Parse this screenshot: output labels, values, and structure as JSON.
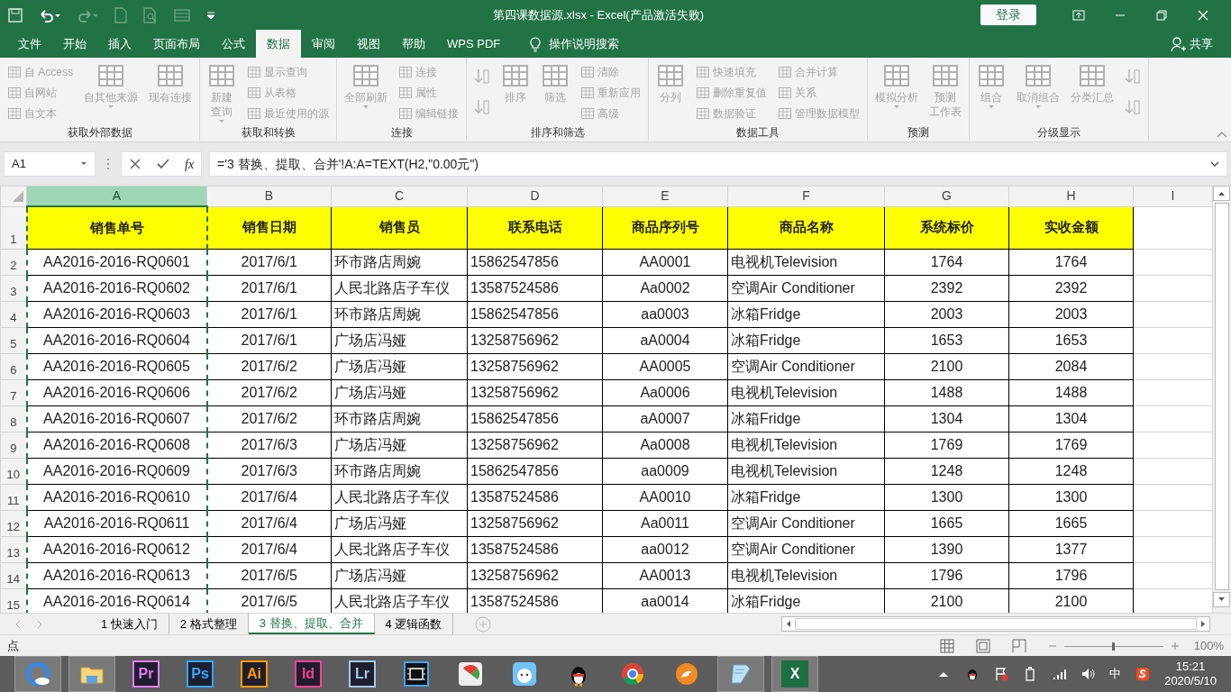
{
  "title_bar": {
    "title": "第四课数据源.xlsx  -  Excel(产品激活失败)",
    "login": "登录"
  },
  "ribbon": {
    "tabs": [
      {
        "label": "文件",
        "selected": false
      },
      {
        "label": "开始",
        "selected": false
      },
      {
        "label": "插入",
        "selected": false
      },
      {
        "label": "页面布局",
        "selected": false
      },
      {
        "label": "公式",
        "selected": false
      },
      {
        "label": "数据",
        "selected": true
      },
      {
        "label": "审阅",
        "selected": false
      },
      {
        "label": "视图",
        "selected": false
      },
      {
        "label": "帮助",
        "selected": false
      },
      {
        "label": "WPS PDF",
        "selected": false
      }
    ],
    "tell_me": "操作说明搜索",
    "share": "共享",
    "groups": [
      {
        "label": "获取外部数据",
        "columns": [
          {
            "kind": "stack",
            "items": [
              {
                "label": "自 Access",
                "disabled": true
              },
              {
                "label": "自网站",
                "disabled": true
              },
              {
                "label": "自文本",
                "disabled": true
              }
            ]
          },
          {
            "kind": "large",
            "lines": [
              "自其他来源"
            ],
            "dropdown": true,
            "disabled": true
          },
          {
            "kind": "large",
            "lines": [
              "现有连接"
            ],
            "dropdown": false,
            "disabled": true
          }
        ]
      },
      {
        "label": "获取和转换",
        "columns": [
          {
            "kind": "large",
            "lines": [
              "新建",
              "查询"
            ],
            "dropdown": true,
            "disabled": true
          },
          {
            "kind": "stack",
            "items": [
              {
                "label": "显示查询",
                "disabled": true
              },
              {
                "label": "从表格",
                "disabled": true
              },
              {
                "label": "最近使用的源",
                "disabled": true
              }
            ]
          }
        ]
      },
      {
        "label": "连接",
        "columns": [
          {
            "kind": "large",
            "lines": [
              "全部刷新"
            ],
            "dropdown": true,
            "disabled": true
          },
          {
            "kind": "stack",
            "items": [
              {
                "label": "连接",
                "disabled": true
              },
              {
                "label": "属性",
                "disabled": true
              },
              {
                "label": "编辑链接",
                "disabled": true
              }
            ]
          }
        ]
      },
      {
        "label": "排序和筛选",
        "columns": [
          {
            "kind": "stack",
            "items": [
              {
                "disabled": true
              },
              {
                "disabled": true
              }
            ]
          },
          {
            "kind": "large",
            "lines": [
              "排序"
            ],
            "dropdown": false,
            "disabled": true
          },
          {
            "kind": "large",
            "lines": [
              "筛选"
            ],
            "dropdown": false,
            "disabled": true
          },
          {
            "kind": "stack",
            "items": [
              {
                "label": "清除",
                "disabled": true
              },
              {
                "label": "重新应用",
                "disabled": true
              },
              {
                "label": "高级",
                "disabled": true
              }
            ]
          }
        ]
      },
      {
        "label": "数据工具",
        "columns": [
          {
            "kind": "large",
            "lines": [
              "分列"
            ],
            "dropdown": false,
            "disabled": true
          },
          {
            "kind": "stack",
            "items": [
              {
                "label": "快速填充",
                "disabled": true
              },
              {
                "label": "删除重复值",
                "disabled": true
              },
              {
                "label": "数据验证",
                "disabled": true
              }
            ]
          },
          {
            "kind": "stack",
            "items": [
              {
                "label": "合并计算",
                "disabled": true
              },
              {
                "label": "关系",
                "disabled": true
              },
              {
                "label": "管理数据模型",
                "disabled": true
              }
            ]
          }
        ]
      },
      {
        "label": "预测",
        "columns": [
          {
            "kind": "large",
            "lines": [
              "模拟分析"
            ],
            "dropdown": true,
            "disabled": true
          },
          {
            "kind": "large",
            "lines": [
              "预测",
              "工作表"
            ],
            "dropdown": false,
            "disabled": true
          }
        ]
      },
      {
        "label": "分级显示",
        "columns": [
          {
            "kind": "large",
            "lines": [
              "组合"
            ],
            "dropdown": true,
            "disabled": true
          },
          {
            "kind": "large",
            "lines": [
              "取消组合"
            ],
            "dropdown": true,
            "disabled": true
          },
          {
            "kind": "large",
            "lines": [
              "分类汇总"
            ],
            "dropdown": false,
            "disabled": true
          },
          {
            "kind": "stack",
            "items": [
              {
                "disabled": true
              },
              {
                "disabled": true
              }
            ]
          }
        ]
      }
    ]
  },
  "formula_bar": {
    "name_box": "A1",
    "function_label": "fx",
    "formula": "='3 替换、提取、合并'!A:A=TEXT(H2,\"0.00元\")"
  },
  "sheet": {
    "columns": [
      {
        "letter": "A",
        "selected": true,
        "marquee": true
      },
      {
        "letter": "B",
        "selected": false,
        "marquee": false
      },
      {
        "letter": "C",
        "selected": false,
        "marquee": false
      },
      {
        "letter": "D",
        "selected": false,
        "marquee": false
      },
      {
        "letter": "E",
        "selected": false,
        "marquee": false
      },
      {
        "letter": "F",
        "selected": false,
        "marquee": false
      },
      {
        "letter": "G",
        "selected": false,
        "marquee": false
      },
      {
        "letter": "H",
        "selected": false,
        "marquee": false
      },
      {
        "letter": "I",
        "selected": false,
        "marquee": false
      }
    ],
    "rows": [
      {
        "number": "1",
        "kind": "header",
        "cells": [
          "销售单号",
          "销售日期",
          "销售员",
          "联系电话",
          "商品序列号",
          "商品名称",
          "系统标价",
          "实收金额"
        ]
      },
      {
        "number": "2",
        "kind": "data",
        "cells": [
          "AA2016-2016-RQ0601",
          "2017/6/1",
          "环市路店周婉",
          "15862547856",
          "AA0001",
          "电视机Television",
          "1764",
          "1764"
        ]
      },
      {
        "number": "3",
        "kind": "data",
        "cells": [
          "AA2016-2016-RQ0602",
          "2017/6/1",
          "人民北路店子车仪",
          "13587524586",
          "Aa0002",
          "空调Air Conditioner",
          "2392",
          "2392"
        ]
      },
      {
        "number": "4",
        "kind": "data",
        "cells": [
          "AA2016-2016-RQ0603",
          "2017/6/1",
          "环市路店周婉",
          "15862547856",
          "aa0003",
          "冰箱Fridge",
          "2003",
          "2003"
        ]
      },
      {
        "number": "5",
        "kind": "data",
        "cells": [
          "AA2016-2016-RQ0604",
          "2017/6/1",
          "广场店冯娅",
          "13258756962",
          "aA0004",
          "冰箱Fridge",
          "1653",
          "1653"
        ]
      },
      {
        "number": "6",
        "kind": "data",
        "cells": [
          "AA2016-2016-RQ0605",
          "2017/6/2",
          "广场店冯娅",
          "13258756962",
          "AA0005",
          "空调Air Conditioner",
          "2100",
          "2084"
        ]
      },
      {
        "number": "7",
        "kind": "data",
        "cells": [
          "AA2016-2016-RQ0606",
          "2017/6/2",
          "广场店冯娅",
          "13258756962",
          "Aa0006",
          "电视机Television",
          "1488",
          "1488"
        ]
      },
      {
        "number": "8",
        "kind": "data",
        "cells": [
          "AA2016-2016-RQ0607",
          "2017/6/2",
          "环市路店周婉",
          "15862547856",
          "aA0007",
          "冰箱Fridge",
          "1304",
          "1304"
        ]
      },
      {
        "number": "9",
        "kind": "data",
        "cells": [
          "AA2016-2016-RQ0608",
          "2017/6/3",
          "广场店冯娅",
          "13258756962",
          "Aa0008",
          "电视机Television",
          "1769",
          "1769"
        ]
      },
      {
        "number": "10",
        "kind": "data",
        "cells": [
          "AA2016-2016-RQ0609",
          "2017/6/3",
          "环市路店周婉",
          "15862547856",
          "aa0009",
          "电视机Television",
          "1248",
          "1248"
        ]
      },
      {
        "number": "11",
        "kind": "data",
        "cells": [
          "AA2016-2016-RQ0610",
          "2017/6/4",
          "人民北路店子车仪",
          "13587524586",
          "AA0010",
          "冰箱Fridge",
          "1300",
          "1300"
        ]
      },
      {
        "number": "12",
        "kind": "data",
        "cells": [
          "AA2016-2016-RQ0611",
          "2017/6/4",
          "广场店冯娅",
          "13258756962",
          "Aa0011",
          "空调Air Conditioner",
          "1665",
          "1665"
        ]
      },
      {
        "number": "13",
        "kind": "data",
        "cells": [
          "AA2016-2016-RQ0612",
          "2017/6/4",
          "人民北路店子车仪",
          "13587524586",
          "aa0012",
          "空调Air Conditioner",
          "1390",
          "1377"
        ]
      },
      {
        "number": "14",
        "kind": "data",
        "cells": [
          "AA2016-2016-RQ0613",
          "2017/6/5",
          "广场店冯娅",
          "13258756962",
          "AA0013",
          "电视机Television",
          "1796",
          "1796"
        ]
      },
      {
        "number": "15",
        "kind": "data",
        "cells": [
          "AA2016-2016-RQ0614",
          "2017/6/5",
          "人民北路店子车仪",
          "13587524586",
          "aa0014",
          "冰箱Fridge",
          "2100",
          "2100"
        ]
      }
    ]
  },
  "sheet_tabs": [
    {
      "label": "1 快速入门",
      "selected": false
    },
    {
      "label": "2 格式整理",
      "selected": false
    },
    {
      "label": "3 替换、提取、合并",
      "selected": true
    },
    {
      "label": "4 逻辑函数",
      "selected": false
    }
  ],
  "status_bar": {
    "text": "点",
    "zoom": "100%",
    "zoom_slider": {
      "level": 0.5
    }
  },
  "taskbar": {
    "apps": [
      {
        "kind": "ring",
        "running": true
      },
      {
        "kind": "folder",
        "running": true
      },
      {
        "kind": "badge",
        "label": "Pr",
        "color": "#e77cf0",
        "running": false
      },
      {
        "kind": "badge",
        "label": "Ps",
        "color": "#31a8ff",
        "running": false
      },
      {
        "kind": "badge",
        "label": "Ai",
        "color": "#ff9a00",
        "running": false
      },
      {
        "kind": "badge",
        "label": "Id",
        "color": "#ff3f94",
        "running": false
      },
      {
        "kind": "badge",
        "label": "Lr",
        "color": "#a3c9e8",
        "running": false
      },
      {
        "kind": "film",
        "running": false
      },
      {
        "kind": "slices",
        "running": false
      },
      {
        "kind": "mascot",
        "running": false
      },
      {
        "kind": "penguin",
        "running": false
      },
      {
        "kind": "chrome",
        "running": false
      },
      {
        "kind": "fox",
        "running": false
      },
      {
        "kind": "notepad",
        "running": true
      },
      {
        "kind": "badge",
        "label": "X",
        "color": "#1d7044",
        "running": true
      }
    ],
    "tray": [
      {
        "kind": "caret"
      },
      {
        "kind": "penguin"
      },
      {
        "kind": "flag"
      },
      {
        "kind": "battery"
      },
      {
        "kind": "signal"
      },
      {
        "kind": "speaker"
      },
      {
        "kind": "text",
        "label": "中"
      },
      {
        "kind": "sogou"
      }
    ],
    "time": "15:21",
    "date": "2020/5/10"
  }
}
